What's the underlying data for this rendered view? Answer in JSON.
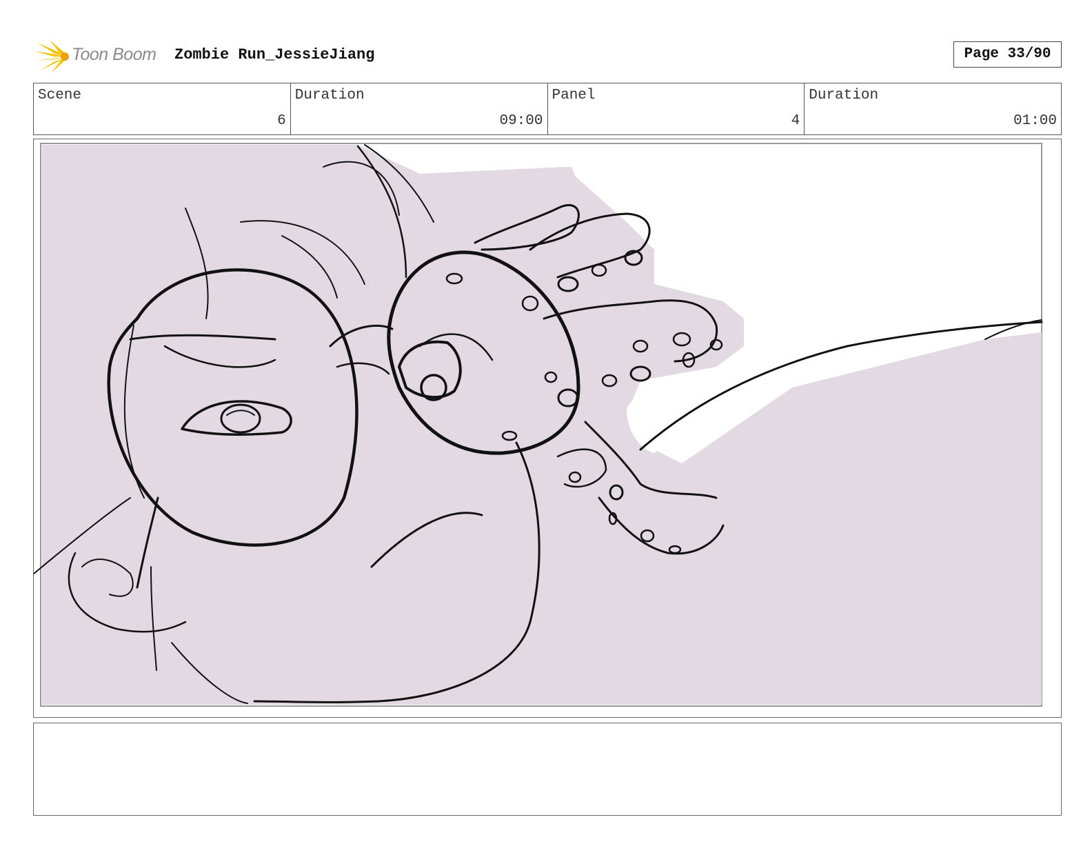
{
  "header": {
    "logo_text": "Toon Boom",
    "project_title": "Zombie Run_JessieJiang",
    "page": "Page 33/90"
  },
  "info": {
    "scene_label": "Scene",
    "scene_value": "6",
    "scene_duration_label": "Duration",
    "scene_duration_value": "09:00",
    "panel_label": "Panel",
    "panel_value": "4",
    "panel_duration_label": "Duration",
    "panel_duration_value": "01:00"
  },
  "notes": {
    "text": ""
  },
  "colors": {
    "sketch_fill": "#e3d9e3",
    "ink": "#111111",
    "logo_yellow": "#f5c400",
    "logo_text": "#8a8a8a"
  },
  "icons": {
    "logo": "starburst-icon"
  }
}
